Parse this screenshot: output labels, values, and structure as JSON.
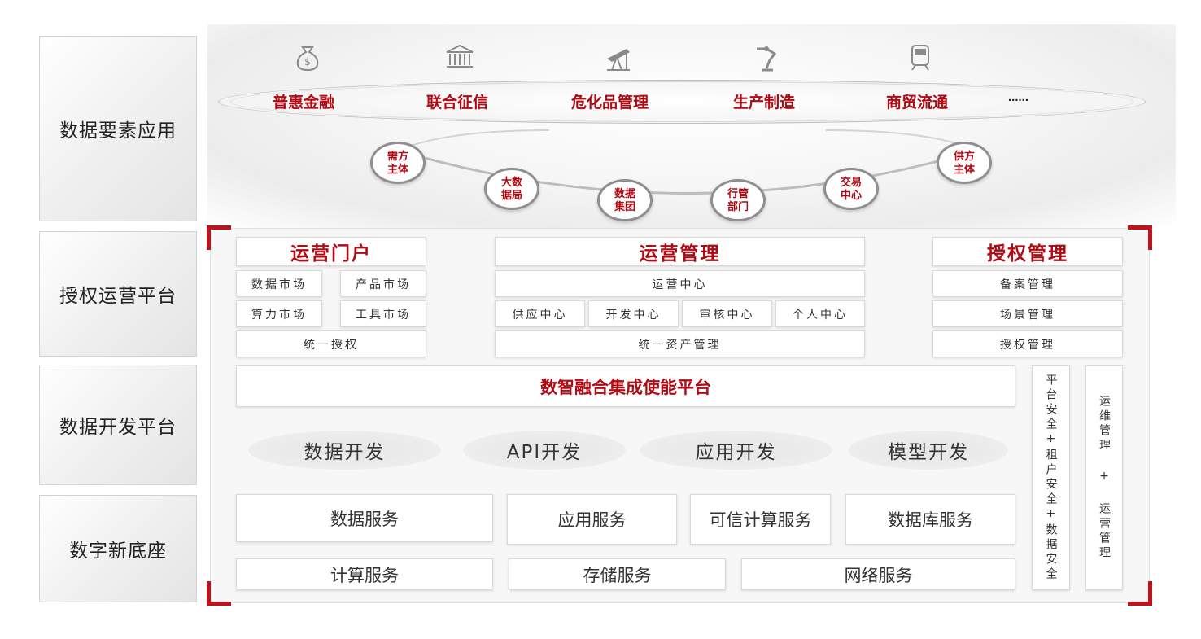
{
  "layers": [
    "数据要素应用",
    "授权运营平台",
    "数据开发平台",
    "数字新底座"
  ],
  "scenes": [
    "普惠金融",
    "联合征信",
    "危化品管理",
    "生产制造",
    "商贸流通",
    "......"
  ],
  "icons": [
    "money-bag-icon",
    "bank-icon",
    "oil-pump-icon",
    "robot-arm-icon",
    "train-icon"
  ],
  "nodes": [
    "需方主体",
    "大数据局",
    "数据集团",
    "行管部门",
    "交易中心",
    "供方主体"
  ],
  "portal": {
    "title": "运营门户",
    "items": [
      "数据市场",
      "产品市场",
      "算力市场",
      "工具市场",
      "统一授权"
    ]
  },
  "ops": {
    "title": "运营管理",
    "center": "运营中心",
    "sub": [
      "供应中心",
      "开发中心",
      "审核中心",
      "个人中心"
    ],
    "asset": "统一资产管理"
  },
  "auth": {
    "title": "授权管理",
    "items": [
      "备案管理",
      "场景管理",
      "授权管理"
    ]
  },
  "platform_banner": "数智融合集成使能平台",
  "dev": [
    "数据开发",
    "API开发",
    "应用开发",
    "模型开发"
  ],
  "services_row1": [
    "数据服务",
    "应用服务",
    "可信计算服务",
    "数据库服务"
  ],
  "services_row2": [
    "计算服务",
    "存储服务",
    "网络服务"
  ],
  "side": {
    "security": "平台安全+租户安全+数据安全",
    "operations": "运维管理 + 运营管理"
  },
  "colors": {
    "accent": "#b00a14",
    "frame_corner": "#c0121c",
    "node_border": "#8f8f8f"
  }
}
